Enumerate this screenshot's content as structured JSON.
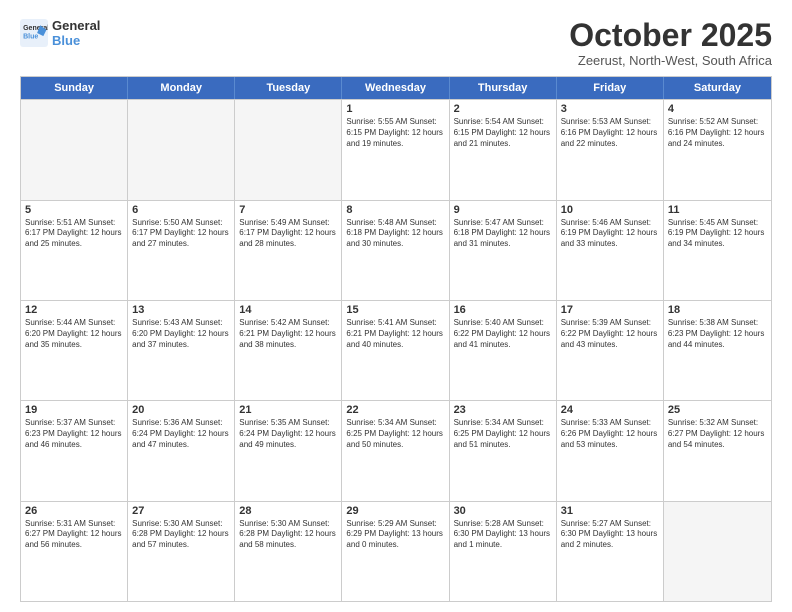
{
  "logo": {
    "line1": "General",
    "line2": "Blue"
  },
  "title": "October 2025",
  "subtitle": "Zeerust, North-West, South Africa",
  "days": [
    "Sunday",
    "Monday",
    "Tuesday",
    "Wednesday",
    "Thursday",
    "Friday",
    "Saturday"
  ],
  "weeks": [
    [
      {
        "day": "",
        "info": "",
        "empty": true
      },
      {
        "day": "",
        "info": "",
        "empty": true
      },
      {
        "day": "",
        "info": "",
        "empty": true
      },
      {
        "day": "1",
        "info": "Sunrise: 5:55 AM\nSunset: 6:15 PM\nDaylight: 12 hours\nand 19 minutes.",
        "empty": false
      },
      {
        "day": "2",
        "info": "Sunrise: 5:54 AM\nSunset: 6:15 PM\nDaylight: 12 hours\nand 21 minutes.",
        "empty": false
      },
      {
        "day": "3",
        "info": "Sunrise: 5:53 AM\nSunset: 6:16 PM\nDaylight: 12 hours\nand 22 minutes.",
        "empty": false
      },
      {
        "day": "4",
        "info": "Sunrise: 5:52 AM\nSunset: 6:16 PM\nDaylight: 12 hours\nand 24 minutes.",
        "empty": false
      }
    ],
    [
      {
        "day": "5",
        "info": "Sunrise: 5:51 AM\nSunset: 6:17 PM\nDaylight: 12 hours\nand 25 minutes.",
        "empty": false
      },
      {
        "day": "6",
        "info": "Sunrise: 5:50 AM\nSunset: 6:17 PM\nDaylight: 12 hours\nand 27 minutes.",
        "empty": false
      },
      {
        "day": "7",
        "info": "Sunrise: 5:49 AM\nSunset: 6:17 PM\nDaylight: 12 hours\nand 28 minutes.",
        "empty": false
      },
      {
        "day": "8",
        "info": "Sunrise: 5:48 AM\nSunset: 6:18 PM\nDaylight: 12 hours\nand 30 minutes.",
        "empty": false
      },
      {
        "day": "9",
        "info": "Sunrise: 5:47 AM\nSunset: 6:18 PM\nDaylight: 12 hours\nand 31 minutes.",
        "empty": false
      },
      {
        "day": "10",
        "info": "Sunrise: 5:46 AM\nSunset: 6:19 PM\nDaylight: 12 hours\nand 33 minutes.",
        "empty": false
      },
      {
        "day": "11",
        "info": "Sunrise: 5:45 AM\nSunset: 6:19 PM\nDaylight: 12 hours\nand 34 minutes.",
        "empty": false
      }
    ],
    [
      {
        "day": "12",
        "info": "Sunrise: 5:44 AM\nSunset: 6:20 PM\nDaylight: 12 hours\nand 35 minutes.",
        "empty": false
      },
      {
        "day": "13",
        "info": "Sunrise: 5:43 AM\nSunset: 6:20 PM\nDaylight: 12 hours\nand 37 minutes.",
        "empty": false
      },
      {
        "day": "14",
        "info": "Sunrise: 5:42 AM\nSunset: 6:21 PM\nDaylight: 12 hours\nand 38 minutes.",
        "empty": false
      },
      {
        "day": "15",
        "info": "Sunrise: 5:41 AM\nSunset: 6:21 PM\nDaylight: 12 hours\nand 40 minutes.",
        "empty": false
      },
      {
        "day": "16",
        "info": "Sunrise: 5:40 AM\nSunset: 6:22 PM\nDaylight: 12 hours\nand 41 minutes.",
        "empty": false
      },
      {
        "day": "17",
        "info": "Sunrise: 5:39 AM\nSunset: 6:22 PM\nDaylight: 12 hours\nand 43 minutes.",
        "empty": false
      },
      {
        "day": "18",
        "info": "Sunrise: 5:38 AM\nSunset: 6:23 PM\nDaylight: 12 hours\nand 44 minutes.",
        "empty": false
      }
    ],
    [
      {
        "day": "19",
        "info": "Sunrise: 5:37 AM\nSunset: 6:23 PM\nDaylight: 12 hours\nand 46 minutes.",
        "empty": false
      },
      {
        "day": "20",
        "info": "Sunrise: 5:36 AM\nSunset: 6:24 PM\nDaylight: 12 hours\nand 47 minutes.",
        "empty": false
      },
      {
        "day": "21",
        "info": "Sunrise: 5:35 AM\nSunset: 6:24 PM\nDaylight: 12 hours\nand 49 minutes.",
        "empty": false
      },
      {
        "day": "22",
        "info": "Sunrise: 5:34 AM\nSunset: 6:25 PM\nDaylight: 12 hours\nand 50 minutes.",
        "empty": false
      },
      {
        "day": "23",
        "info": "Sunrise: 5:34 AM\nSunset: 6:25 PM\nDaylight: 12 hours\nand 51 minutes.",
        "empty": false
      },
      {
        "day": "24",
        "info": "Sunrise: 5:33 AM\nSunset: 6:26 PM\nDaylight: 12 hours\nand 53 minutes.",
        "empty": false
      },
      {
        "day": "25",
        "info": "Sunrise: 5:32 AM\nSunset: 6:27 PM\nDaylight: 12 hours\nand 54 minutes.",
        "empty": false
      }
    ],
    [
      {
        "day": "26",
        "info": "Sunrise: 5:31 AM\nSunset: 6:27 PM\nDaylight: 12 hours\nand 56 minutes.",
        "empty": false
      },
      {
        "day": "27",
        "info": "Sunrise: 5:30 AM\nSunset: 6:28 PM\nDaylight: 12 hours\nand 57 minutes.",
        "empty": false
      },
      {
        "day": "28",
        "info": "Sunrise: 5:30 AM\nSunset: 6:28 PM\nDaylight: 12 hours\nand 58 minutes.",
        "empty": false
      },
      {
        "day": "29",
        "info": "Sunrise: 5:29 AM\nSunset: 6:29 PM\nDaylight: 13 hours\nand 0 minutes.",
        "empty": false
      },
      {
        "day": "30",
        "info": "Sunrise: 5:28 AM\nSunset: 6:30 PM\nDaylight: 13 hours\nand 1 minute.",
        "empty": false
      },
      {
        "day": "31",
        "info": "Sunrise: 5:27 AM\nSunset: 6:30 PM\nDaylight: 13 hours\nand 2 minutes.",
        "empty": false
      },
      {
        "day": "",
        "info": "",
        "empty": true
      }
    ]
  ]
}
